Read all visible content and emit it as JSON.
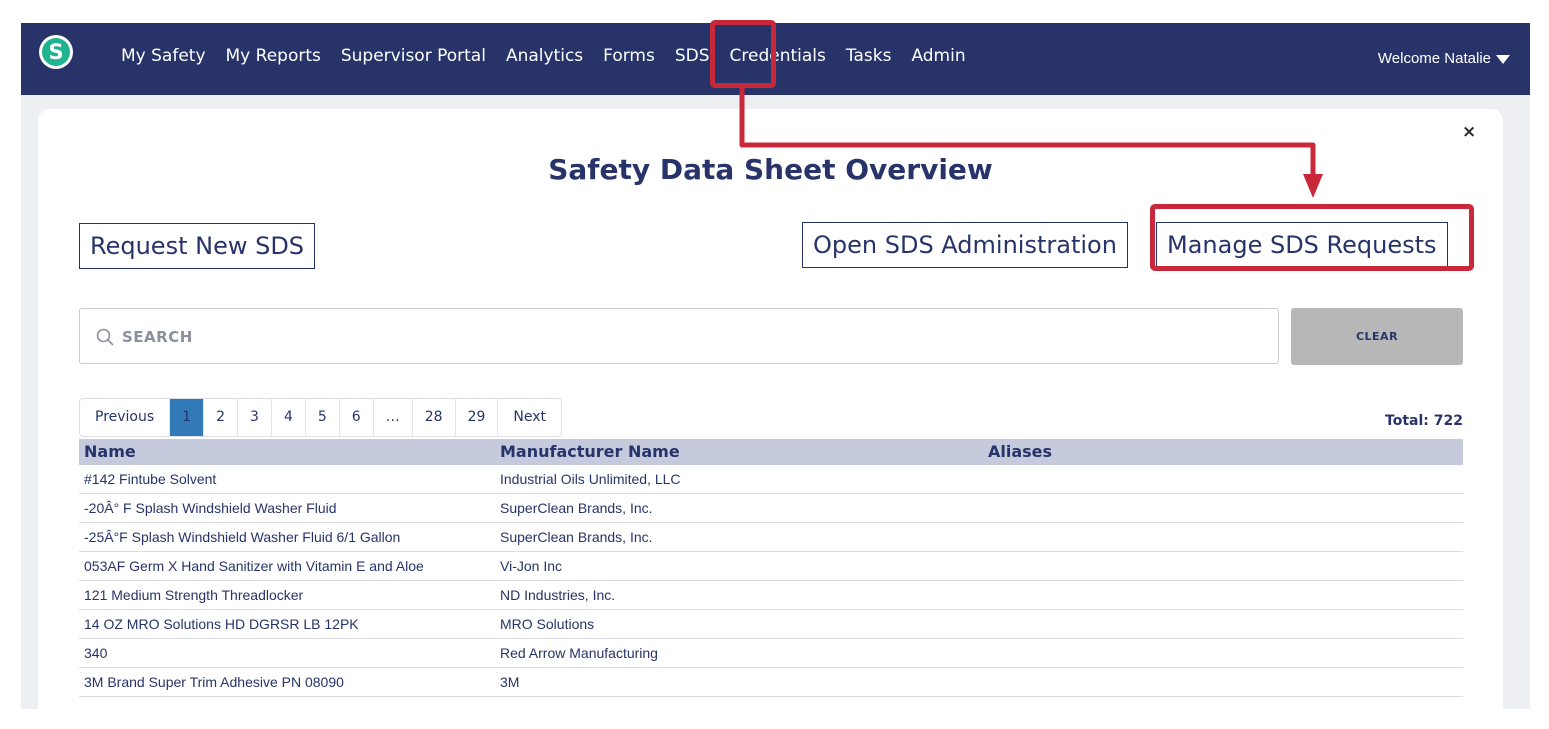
{
  "nav": {
    "logo_letter": "S",
    "items": [
      {
        "label": "My Safety",
        "id": "my-safety"
      },
      {
        "label": "My Reports",
        "id": "my-reports"
      },
      {
        "label": "Supervisor Portal",
        "id": "supervisor-portal"
      },
      {
        "label": "Analytics",
        "id": "analytics"
      },
      {
        "label": "Forms",
        "id": "forms"
      },
      {
        "label": "SDS",
        "id": "sds"
      },
      {
        "label": "Credentials",
        "id": "credentials"
      },
      {
        "label": "Tasks",
        "id": "tasks"
      },
      {
        "label": "Admin",
        "id": "admin"
      }
    ],
    "welcome": "Welcome Natalie"
  },
  "panel": {
    "close_symbol": "×",
    "title": "Safety Data Sheet Overview",
    "request_new": "Request New SDS",
    "open_admin": "Open SDS Administration",
    "manage_requests": "Manage SDS Requests"
  },
  "search": {
    "placeholder": "SEARCH",
    "clear_label": "CLEAR"
  },
  "pagination": {
    "previous": "Previous",
    "next": "Next",
    "pages": [
      "1",
      "2",
      "3",
      "4",
      "5",
      "6",
      "…",
      "28",
      "29"
    ],
    "current_page": "1",
    "total": "Total: 722"
  },
  "table": {
    "columns": [
      "Name",
      "Manufacturer Name",
      "Aliases"
    ],
    "rows": [
      [
        "#142 Fintube Solvent",
        "Industrial Oils Unlimited, LLC",
        ""
      ],
      [
        "-20Â° F Splash Windshield Washer Fluid",
        "SuperClean Brands, Inc.",
        ""
      ],
      [
        "-25Â°F Splash Windshield Washer Fluid 6/1 Gallon",
        "SuperClean Brands, Inc.",
        ""
      ],
      [
        "053AF Germ X Hand Sanitizer with Vitamin E and Aloe",
        "Vi-Jon Inc",
        ""
      ],
      [
        "121 Medium Strength Threadlocker",
        "ND Industries, Inc.",
        ""
      ],
      [
        "14 OZ MRO Solutions HD DGRSR LB 12PK",
        "MRO Solutions",
        ""
      ],
      [
        "340",
        "Red Arrow Manufacturing",
        ""
      ],
      [
        "3M Brand Super Trim Adhesive PN 08090",
        "3M",
        ""
      ]
    ]
  },
  "colors": {
    "navbar": "#283469",
    "brand_text": "#283469",
    "logo": "#1fb38f",
    "annotation": "#c8283a",
    "active_page": "#3279b7",
    "header_row": "#c5cbdd",
    "clear_button": "#b7b7b7"
  },
  "icons": {
    "search": "search-icon",
    "caret": "caret-down-icon",
    "close": "close-icon"
  }
}
